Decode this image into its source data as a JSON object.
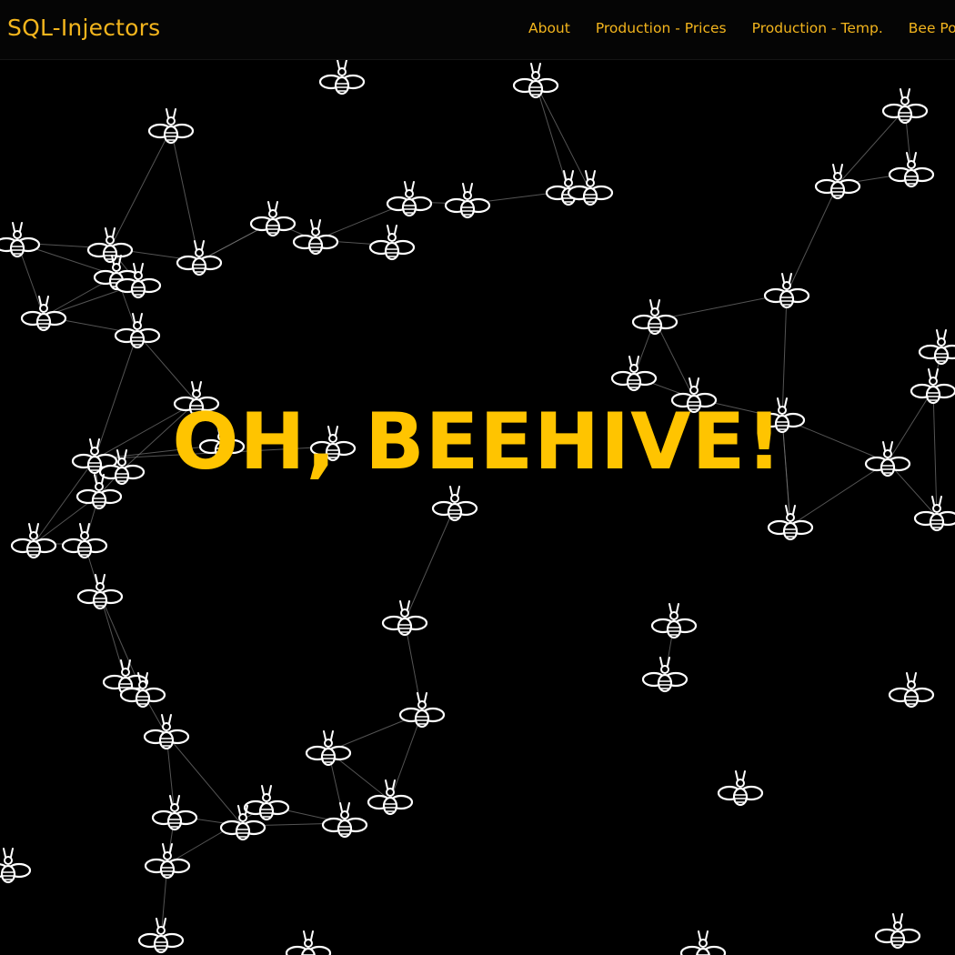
{
  "brand": "SQL-Injectors",
  "nav": [
    "About",
    "Production - Prices",
    "Production - Temp.",
    "Bee Popu"
  ],
  "hero": {
    "title": "OH, BEEHIVE!"
  },
  "colors": {
    "accent": "#ffc400",
    "background": "#000000",
    "bee": "#ffffff",
    "edge": "#777777"
  },
  "icon": "bee-icon"
}
